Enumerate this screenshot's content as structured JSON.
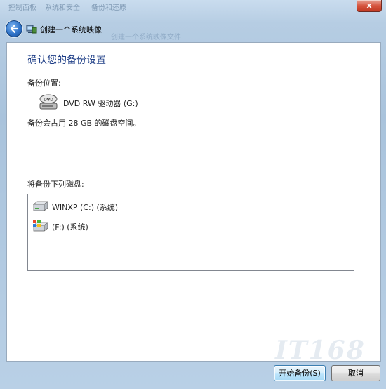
{
  "window": {
    "breadcrumbs": [
      "控制面板",
      "系统和安全",
      "备份和还原"
    ],
    "close_label": "x"
  },
  "nav": {
    "title": "创建一个系统映像",
    "ghost_text": "创建一个系统映像文件"
  },
  "content": {
    "heading": "确认您的备份设置",
    "location_label": "备份位置:",
    "location_device": "DVD RW 驱动器 (G:)",
    "dvd_icon_text": "DVD",
    "space_note": "备份会占用 28 GB 的磁盘空间。",
    "disks_label": "将备份下列磁盘:",
    "disks": [
      {
        "label": "WINXP (C:) (系统)",
        "icon": "hard-drive-icon"
      },
      {
        "label": "(F:) (系统)",
        "icon": "windows-drive-icon"
      }
    ]
  },
  "buttons": {
    "start": "开始备份(S)",
    "cancel": "取消"
  },
  "watermark": "IT168",
  "colors": {
    "heading": "#1e3e87",
    "frame": "#b6cde3",
    "default_button": "#bee6fd"
  }
}
